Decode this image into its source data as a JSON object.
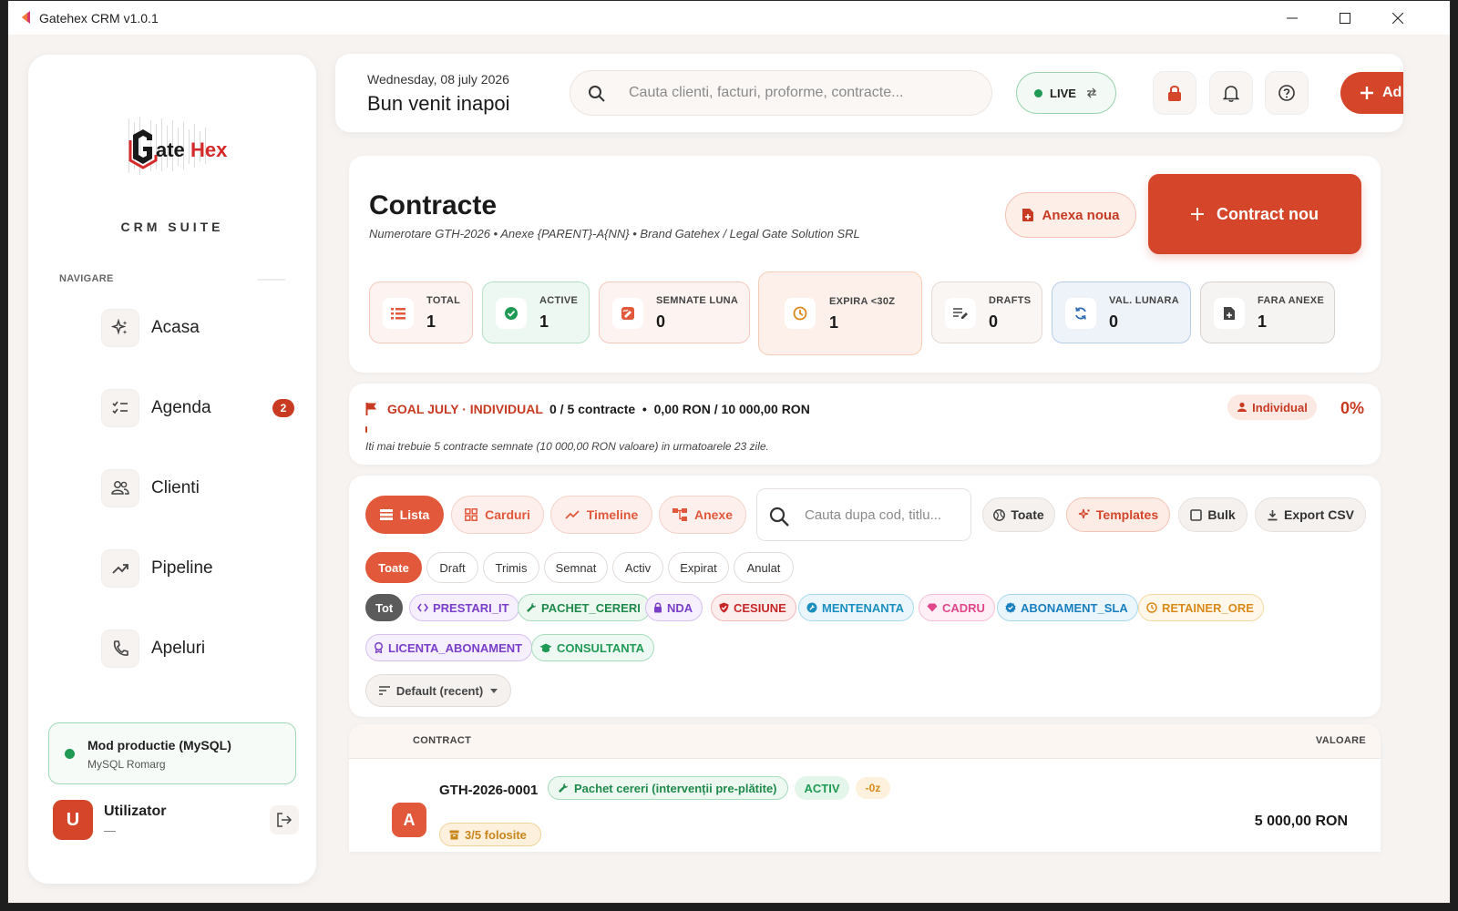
{
  "window": {
    "title": "Gatehex CRM v1.0.1"
  },
  "sidebar": {
    "logo_text": "GateHex",
    "suite": "CRM SUITE",
    "nav_label": "NAVIGARE",
    "items": [
      {
        "label": "Acasa",
        "icon": "sparkle-icon"
      },
      {
        "label": "Agenda",
        "icon": "checklist-icon",
        "badge": "2"
      },
      {
        "label": "Clienti",
        "icon": "users-icon"
      },
      {
        "label": "Pipeline",
        "icon": "trend-icon"
      },
      {
        "label": "Apeluri",
        "icon": "phone-icon"
      }
    ],
    "db": {
      "title": "Mod productie (MySQL)",
      "subtitle": "MySQL Romarg"
    },
    "user": {
      "initial": "U",
      "name": "Utilizator",
      "sub": "—"
    }
  },
  "header": {
    "date": "Wednesday, 08 july 2026",
    "welcome": "Bun venit inapoi",
    "search_placeholder": "Cauta clienti, facturi, proforme, contracte...",
    "live": "LIVE",
    "add_label": "Ad"
  },
  "contracts": {
    "title": "Contracte",
    "subtitle": "Numerotare GTH-2026 • Anexe {PARENT}-A{NN} • Brand Gatehex / Legal Gate Solution SRL",
    "anexa_label": "Anexa noua",
    "new_label": "Contract nou",
    "stats": [
      {
        "label": "TOTAL",
        "value": "1"
      },
      {
        "label": "ACTIVE",
        "value": "1"
      },
      {
        "label": "SEMNATE LUNA",
        "value": "0"
      },
      {
        "label": "EXPIRA <30Z",
        "value": "1"
      },
      {
        "label": "DRAFTS",
        "value": "0"
      },
      {
        "label": "VAL. LUNARA",
        "value": "0"
      },
      {
        "label": "FARA ANEXE",
        "value": "1"
      }
    ]
  },
  "goal": {
    "title": "GOAL JULY · INDIVIDUAL",
    "progress": "0 / 5 contracte  •  0,00 RON / 10 000,00 RON",
    "note": "Iti mai trebuie 5 contracte semnate (10 000,00 RON valoare) in urmatoarele 23 zile.",
    "badge": "Individual",
    "percent": "0%",
    "progress_fraction": 0
  },
  "list": {
    "views": [
      "Lista",
      "Carduri",
      "Timeline",
      "Anexe"
    ],
    "search_placeholder": "Cauta dupa cod, titlu...",
    "toate_btn": "Toate",
    "templates_btn": "Templates",
    "bulk_btn": "Bulk",
    "export_btn": "Export CSV",
    "status_filters": [
      "Toate",
      "Draft",
      "Trimis",
      "Semnat",
      "Activ",
      "Expirat",
      "Anulat"
    ],
    "type_tags": [
      "Tot",
      "PRESTARI_IT",
      "PACHET_CERERI",
      "NDA",
      "CESIUNE",
      "MENTENANTA",
      "CADRU",
      "ABONAMENT_SLA",
      "RETAINER_ORE",
      "LICENTA_ABONAMENT",
      "CONSULTANTA"
    ],
    "sort_label": "Default (recent)"
  },
  "table": {
    "col_contract": "CONTRACT",
    "col_value": "VALOARE",
    "rows": [
      {
        "avatar": "A",
        "code": "GTH-2026-0001",
        "type": "Pachet cereri (intervenții pre-plătite)",
        "status": "ACTIV",
        "days": "-0z",
        "usage": "3/5 folosite",
        "value": "5 000,00 RON"
      }
    ]
  },
  "colors": {
    "accent": "#d4452a",
    "accent_soft": "#e2583b",
    "green": "#1f9a55"
  }
}
